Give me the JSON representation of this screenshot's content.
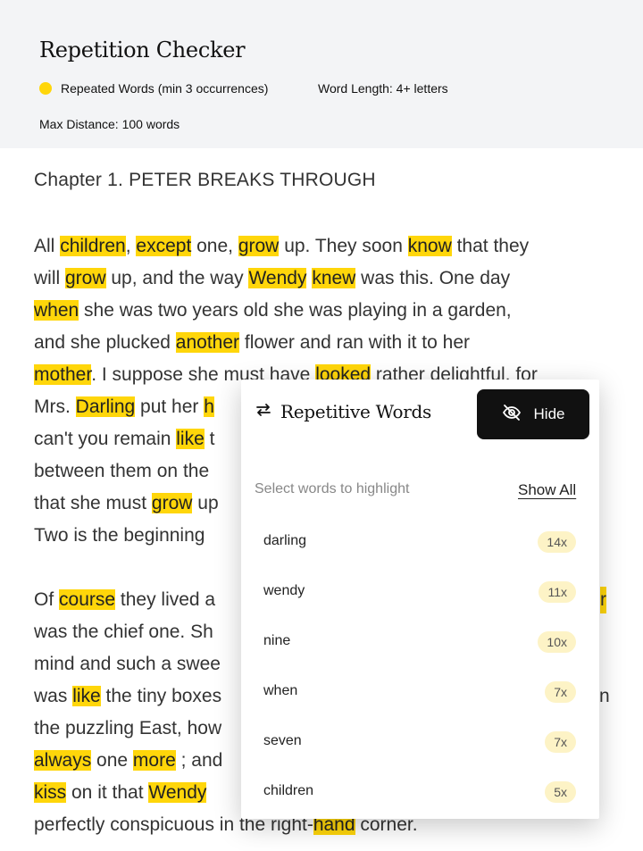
{
  "header": {
    "title": "Repetition Checker",
    "highlight_color": "#ffd60a",
    "repeated_label": "Repeated Words (min 3 occurrences)",
    "word_length_label": "Word Length: 4+ letters",
    "max_distance_label": "Max Distance: 100 words"
  },
  "document": {
    "chapter_title": "Chapter 1. PETER BREAKS THROUGH",
    "lines": [
      [
        [
          "All ",
          false
        ],
        [
          "children",
          true
        ],
        [
          ", ",
          false
        ],
        [
          "except",
          true
        ],
        [
          " one, ",
          false
        ],
        [
          "grow",
          true
        ],
        [
          " up. They soon ",
          false
        ],
        [
          "know",
          true
        ],
        [
          " that they",
          false
        ]
      ],
      [
        [
          "will ",
          false
        ],
        [
          "grow",
          true
        ],
        [
          " up, and the way ",
          false
        ],
        [
          "Wendy",
          true
        ],
        [
          " ",
          false
        ],
        [
          "knew",
          true
        ],
        [
          " was this. One day",
          false
        ]
      ],
      [
        [
          "when",
          true
        ],
        [
          " she was two years old she was playing in a garden,",
          false
        ]
      ],
      [
        [
          "and she plucked ",
          false
        ],
        [
          "another",
          true
        ],
        [
          " flower and ran with it to her",
          false
        ]
      ],
      [
        [
          "mother",
          true
        ],
        [
          ". I suppose she must have ",
          false
        ],
        [
          "looked",
          true
        ],
        [
          " rather delightful, for",
          false
        ]
      ],
      [
        [
          "Mrs. ",
          false
        ],
        [
          "Darling",
          true
        ],
        [
          " put her ",
          false
        ],
        [
          "h",
          true
        ]
      ],
      [
        [
          "can't you remain ",
          false
        ],
        [
          "like",
          true
        ],
        [
          " t",
          false
        ]
      ],
      [
        [
          "between them on the",
          false
        ]
      ],
      [
        [
          "that she must ",
          false
        ],
        [
          "grow",
          true
        ],
        [
          " up",
          false
        ]
      ],
      [
        [
          "Two is the beginning ",
          false
        ]
      ],
      [
        [
          "Of ",
          false
        ],
        [
          "course",
          true
        ],
        [
          " they lived a",
          false
        ]
      ],
      [
        [
          "was the chief one. Sh",
          false
        ]
      ],
      [
        [
          "mind and such a swee",
          false
        ]
      ],
      [
        [
          "was ",
          false
        ],
        [
          "like",
          true
        ],
        [
          " the tiny boxes",
          false
        ]
      ],
      [
        [
          "the puzzling East, how",
          false
        ]
      ],
      [
        [
          "always",
          true
        ],
        [
          " one ",
          false
        ],
        [
          "more",
          true
        ],
        [
          " ; and",
          false
        ]
      ],
      [
        [
          "kiss",
          true
        ],
        [
          " on it that ",
          false
        ],
        [
          "Wendy",
          true
        ],
        [
          " ",
          false
        ]
      ],
      [
        [
          "perfectly conspicuous in the right-",
          false
        ],
        [
          "hand",
          true
        ],
        [
          " corner.",
          false
        ]
      ]
    ],
    "right_fragments": [
      {
        "text": "r",
        "highlighted": true
      },
      {
        "text": "n",
        "highlighted": false
      }
    ]
  },
  "panel": {
    "title": "Repetitive Words",
    "hide_label": "Hide",
    "hint": "Select words to highlight",
    "show_all_label": "Show All",
    "words": [
      {
        "word": "darling",
        "count": "14x"
      },
      {
        "word": "wendy",
        "count": "11x"
      },
      {
        "word": "nine",
        "count": "10x"
      },
      {
        "word": "when",
        "count": "7x"
      },
      {
        "word": "seven",
        "count": "7x"
      },
      {
        "word": "children",
        "count": "5x"
      }
    ]
  }
}
